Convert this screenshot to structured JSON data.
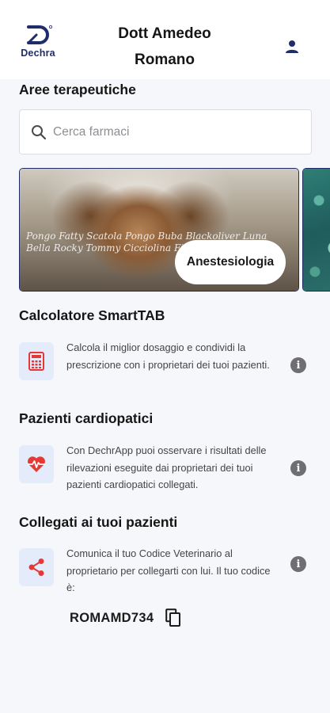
{
  "header": {
    "logo_text": "Dechra",
    "doctor_name_line1": "Dott Amedeo",
    "doctor_name_line2": "Romano",
    "profile_icon": "person-icon"
  },
  "therapy": {
    "title": "Aree terapeutiche",
    "search_placeholder": "Cerca farmaci",
    "cards": [
      {
        "label": "Anestesiologia",
        "script_text": "Pongo Fatty Scatola Pongo Buba Blackoliver Luna Bella Rocky Tommy Cicciolina Fido Max Birba Argo"
      }
    ]
  },
  "features": [
    {
      "title": "Calcolatore SmartTAB",
      "icon": "calculator-icon",
      "text": "Calcola il miglior dosaggio e condividi la prescrizione con i proprietari dei tuoi pazienti."
    },
    {
      "title": "Pazienti cardiopatici",
      "icon": "heartbeat-icon",
      "text": "Con DechrApp puoi osservare i risultati delle rilevazioni eseguite dai proprietari dei tuoi pazienti cardiopatici collegati."
    },
    {
      "title": "Collegati ai tuoi pazienti",
      "icon": "share-icon",
      "text": "Comunica il tuo Codice Veterinario al proprietario per collegarti con lui. Il tuo codice è:"
    }
  ],
  "vet_code": "ROMAMD734",
  "colors": {
    "brand_navy": "#1f2d6b",
    "accent_red": "#e53935",
    "icon_bg": "#e4ecfb",
    "background": "#f6f7fa"
  }
}
